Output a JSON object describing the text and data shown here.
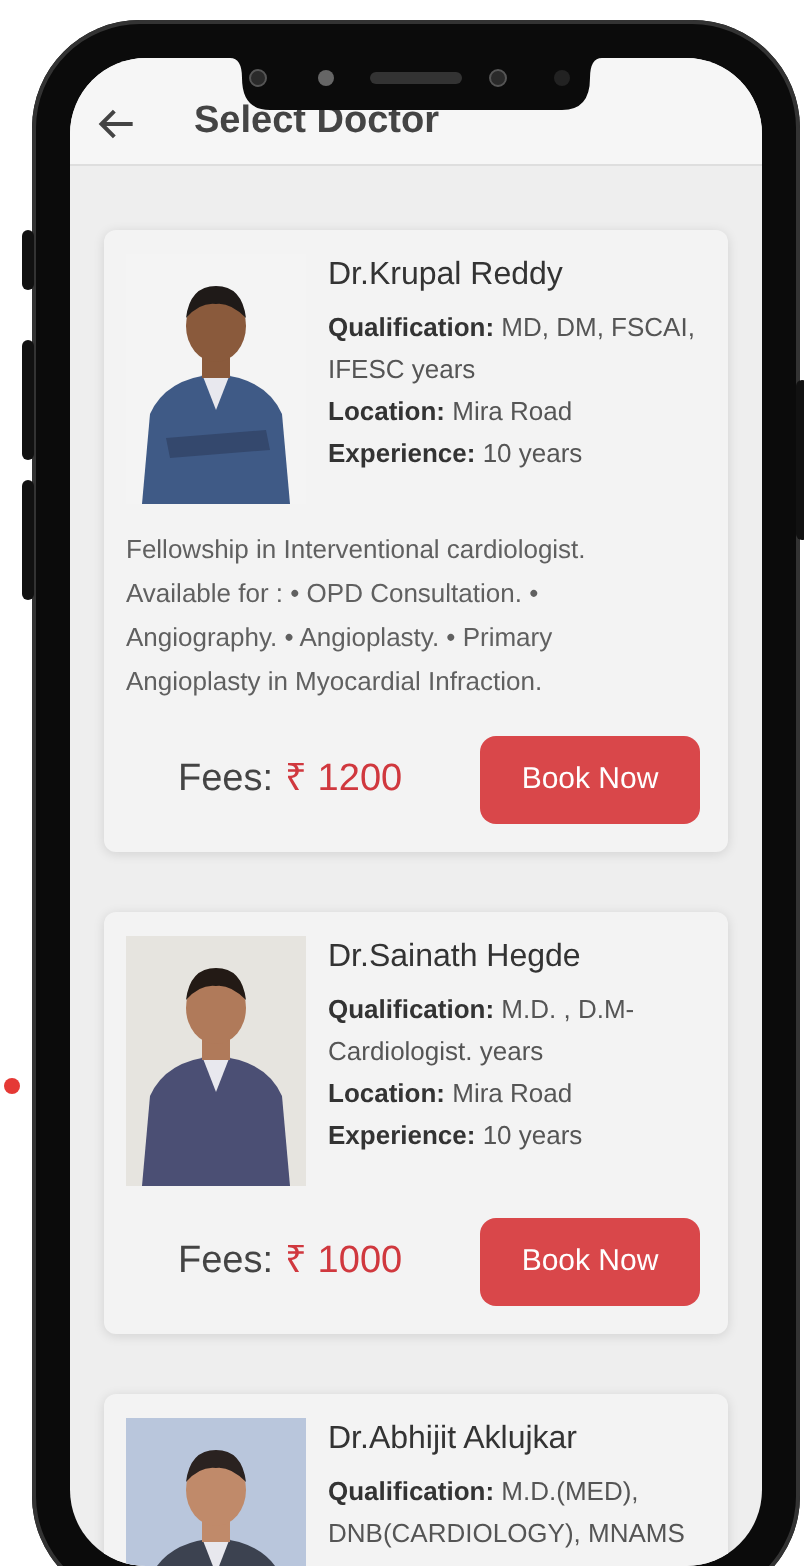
{
  "header": {
    "title": "Select Doctor"
  },
  "doctors": [
    {
      "name": "Dr.Krupal Reddy",
      "details": [
        "**Qualification:** MD, DM, FSCAI, IFESC years",
        "**Location:** Mira Road",
        "**Experience:** 10 years"
      ],
      "description": "Fellowship in Interventional cardiologist. Available for : • OPD Consultation. • Angiography. • Angioplasty. • Primary Angioplasty in Myocardial Infraction.",
      "fees_label": "Fees:",
      "fee": "₹ 1200",
      "button": "Book Now"
    },
    {
      "name": "Dr.Sainath Hegde",
      "details": [
        "**Qualification:** M.D. , D.M-Cardiologist. years",
        "**Location:** Mira Road",
        "**Experience:** 10 years"
      ],
      "fees_label": "Fees:",
      "fee": "₹ 1000",
      "button": "Book Now"
    },
    {
      "name": "Dr.Abhijit Aklujkar",
      "details": [
        "**Qualification:** M.D.(MED), DNB(CARDIOLOGY), MNAMS"
      ]
    }
  ]
}
